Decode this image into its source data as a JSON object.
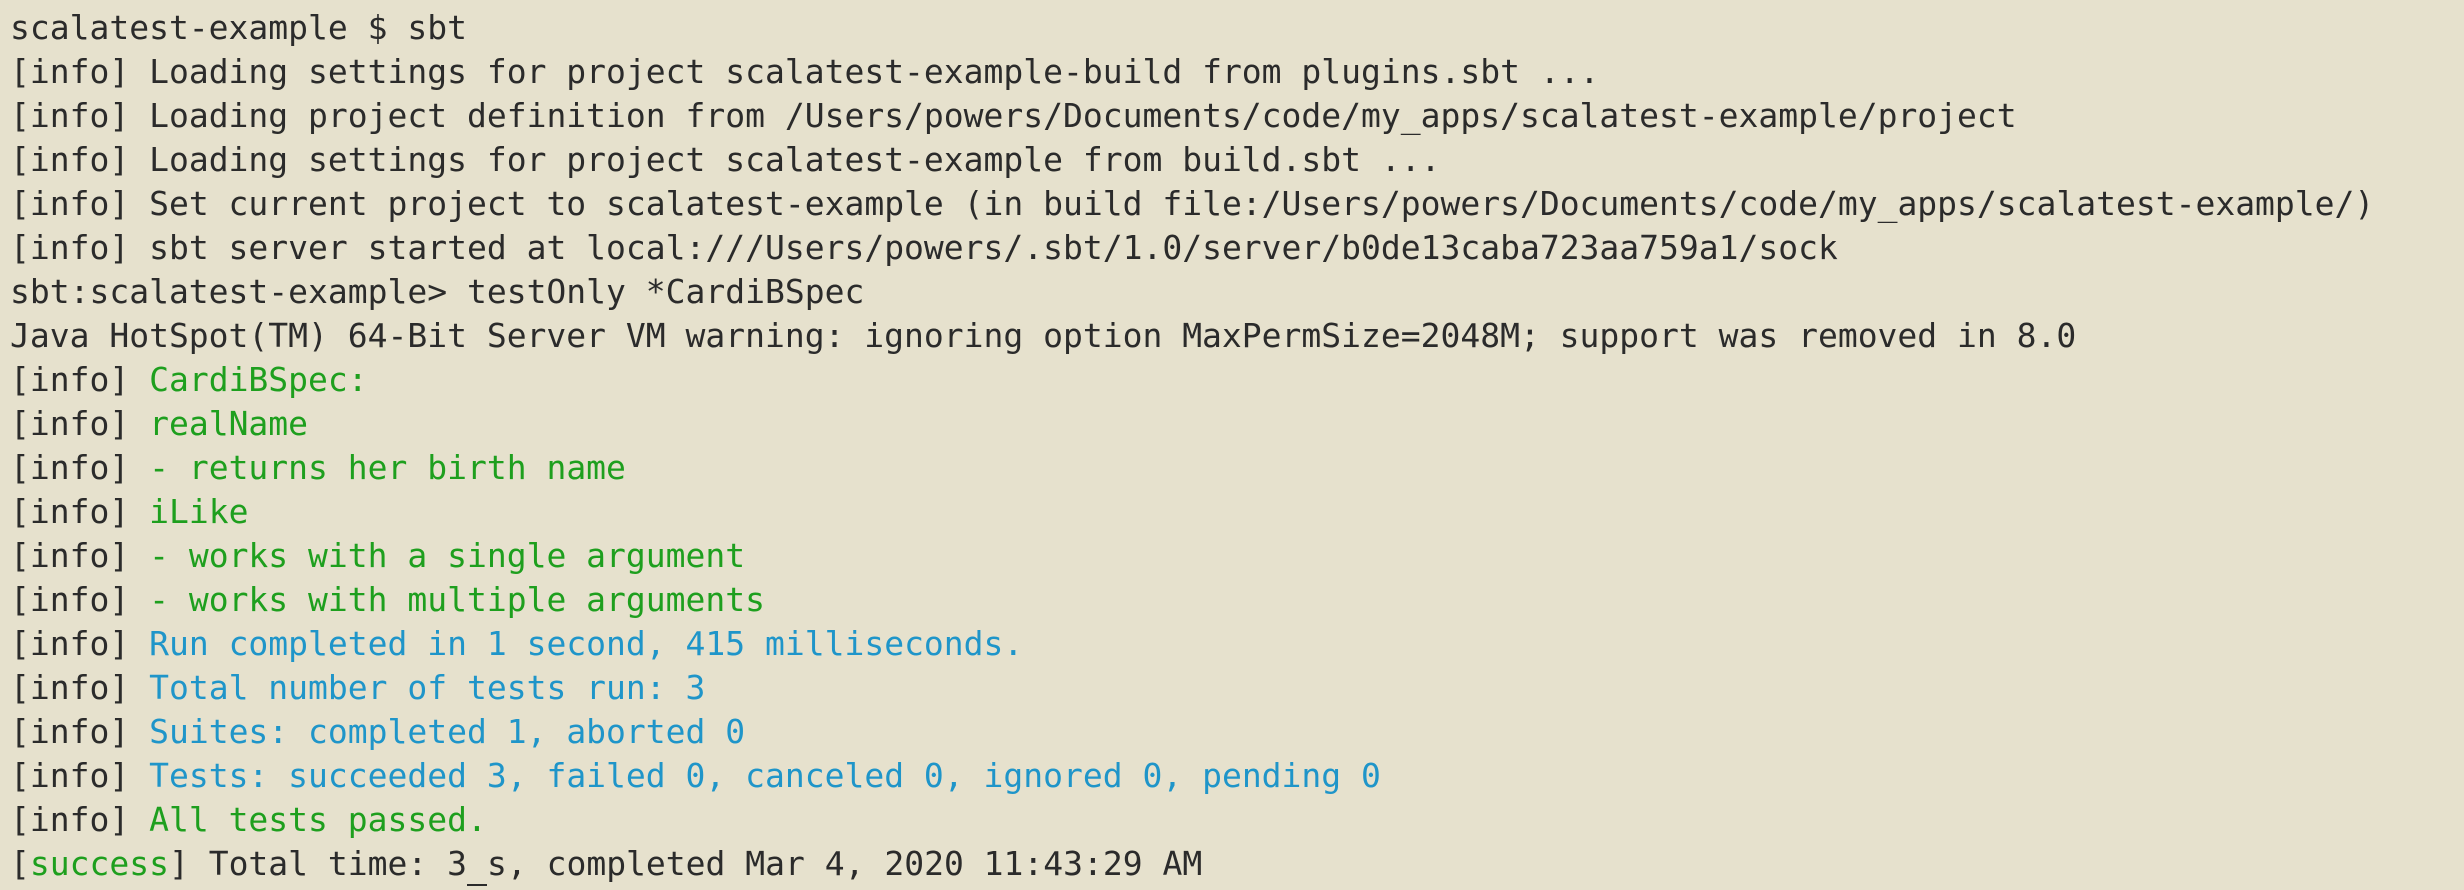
{
  "colors": {
    "background": "#e6e1cd",
    "text": "#2b2b2b",
    "green": "#1e9f1e",
    "cyan": "#1f95c9"
  },
  "terminal": {
    "shell_prompt": "scalatest-example $ sbt",
    "info_prefix": "[info]",
    "sbt_prompt": "sbt:scalatest-example>",
    "sbt_command": " testOnly *CardiBSpec",
    "success_prefix_open": "[",
    "success_word": "success",
    "success_prefix_close": "]",
    "loading_plugins": " Loading settings for project scalatest-example-build from plugins.sbt ...",
    "loading_definition": " Loading project definition from /Users/powers/Documents/code/my_apps/scalatest-example/project",
    "loading_build": " Loading settings for project scalatest-example from build.sbt ...",
    "set_project": " Set current project to scalatest-example (in build file:/Users/powers/Documents/code/my_apps/scalatest-example/)",
    "server_started": " sbt server started at local:///Users/powers/.sbt/1.0/server/b0de13caba723aa759a1/sock",
    "java_warning": "Java HotSpot(TM) 64-Bit Server VM warning: ignoring option MaxPermSize=2048M; support was removed in 8.0",
    "spec_name": "CardiBSpec:",
    "realname": "realName",
    "returns_birth_name": "- returns her birth name",
    "ilike": "iLike",
    "works_single": "- works with a single argument",
    "works_multiple": "- works with multiple arguments",
    "run_completed": "Run completed in 1 second, 415 milliseconds.",
    "total_tests": "Total number of tests run: 3",
    "suites": "Suites: completed 1, aborted 0",
    "tests_summary": "Tests: succeeded 3, failed 0, canceled 0, ignored 0, pending 0",
    "all_passed": "All tests passed.",
    "total_time_before_cursor": " Total time: 3",
    "total_time_after_cursor": "s, completed Mar 4, 2020 11:43:29 AM"
  }
}
